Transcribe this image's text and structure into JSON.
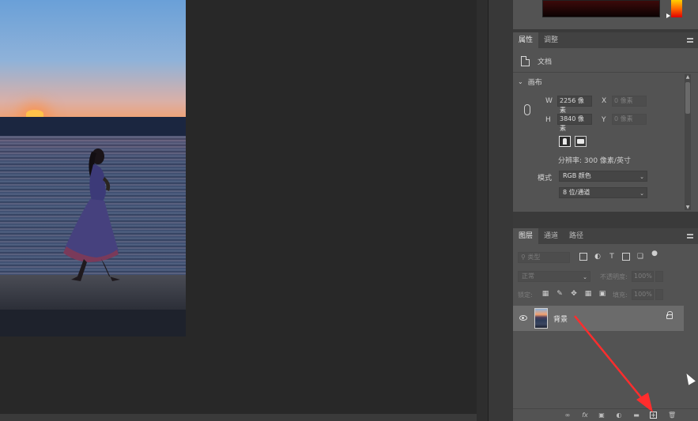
{
  "properties_panel": {
    "tabs": [
      "属性",
      "调整"
    ],
    "document_label": "文档",
    "section_title": "画布",
    "width_label": "W",
    "width_value": "2256 像素",
    "height_label": "H",
    "height_value": "3840 像素",
    "x_label": "X",
    "x_placeholder": "0 像素",
    "y_label": "Y",
    "y_placeholder": "0 像素",
    "resolution": "分辨率: 300 像素/英寸",
    "mode_label": "模式",
    "mode_value": "RGB 颜色",
    "bit_depth": "8 位/通道"
  },
  "layers_panel": {
    "tabs": [
      "图层",
      "通道",
      "路径"
    ],
    "filter_placeholder": "类型",
    "blend_mode": "正常",
    "opacity_label": "不透明度:",
    "opacity_value": "100%",
    "lock_label": "锁定:",
    "fill_label": "填充:",
    "fill_value": "100%",
    "layers": [
      {
        "name": "背景",
        "visible": true,
        "locked": true
      }
    ],
    "bottom_icons": [
      "link-icon",
      "fx-icon",
      "mask-icon",
      "adjustment-icon",
      "group-folder-icon",
      "new-layer-icon",
      "trash-icon"
    ],
    "fx_text": "fx"
  },
  "colors": {
    "panel_bg": "#535353",
    "canvas_bg": "#282828",
    "annotation_arrow": "#ff2d2d"
  }
}
